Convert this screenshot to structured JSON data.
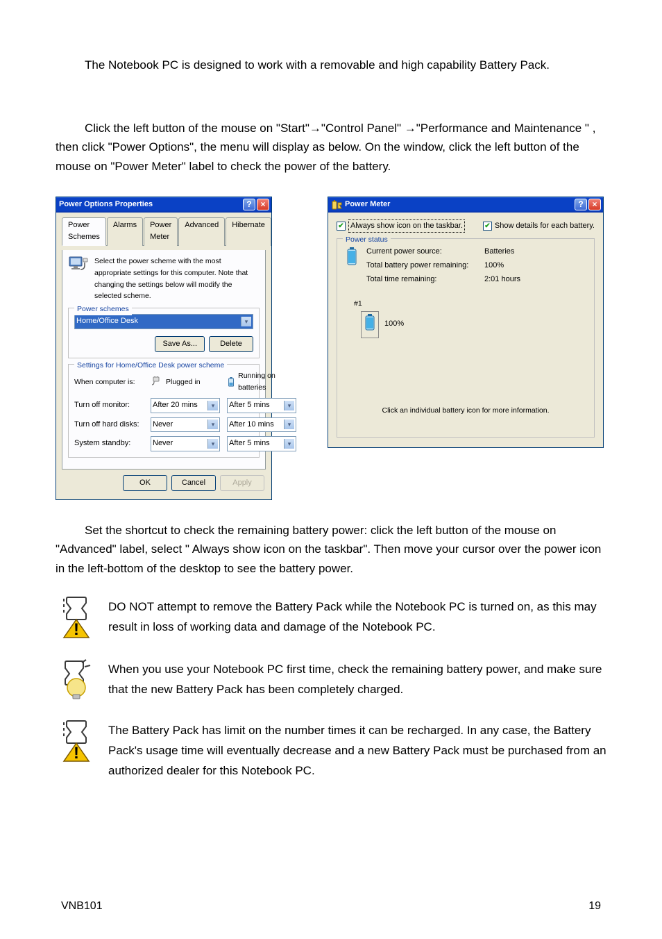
{
  "intro_paragraph": "The Notebook PC is designed to work with a removable and high capability Battery Pack.",
  "nav_paragraph": "Click the left button of the mouse on \"Start\"→\"Control Panel\"  →\"Performance and Maintenance \" , then click \"Power Options\", the menu will display as below. On the window, click the left button of the mouse on \"Power Meter\" label to check the power of the battery.",
  "pop": {
    "title": "Power Options Properties",
    "tabs": [
      "Power Schemes",
      "Alarms",
      "Power Meter",
      "Advanced",
      "Hibernate"
    ],
    "description": "Select the power scheme with the most appropriate settings for this computer. Note that changing the settings below will modify the selected scheme.",
    "group1_legend": "Power schemes",
    "scheme_selected": "Home/Office Desk",
    "save_as_btn": "Save As...",
    "delete_btn": "Delete",
    "group2_legend": "Settings for Home/Office Desk power scheme",
    "when_label": "When computer is:",
    "plugged_label": "Plugged in",
    "battery_label": "Running on batteries",
    "rows": [
      {
        "label": "Turn off monitor:",
        "plugged": "After 20 mins",
        "batt": "After 5 mins"
      },
      {
        "label": "Turn off hard disks:",
        "plugged": "Never",
        "batt": "After 10 mins"
      },
      {
        "label": "System standby:",
        "plugged": "Never",
        "batt": "After 5 mins"
      }
    ],
    "ok": "OK",
    "cancel": "Cancel",
    "apply": "Apply"
  },
  "pm": {
    "title": "Power Meter",
    "chk1": "Always show icon on the taskbar.",
    "chk2": "Show details for each battery.",
    "group_legend": "Power status",
    "lines": [
      {
        "k": "Current power source:",
        "v": "Batteries"
      },
      {
        "k": "Total battery power remaining:",
        "v": "100%"
      },
      {
        "k": "Total time remaining:",
        "v": "2:01 hours"
      }
    ],
    "batt_id": "#1",
    "batt_pct": "100%",
    "footer_hint": "Click an individual battery icon for more information."
  },
  "shortcut_paragraph": "Set the shortcut to check the remaining battery power: click the left button of the mouse on \"Advanced\" label, select \" Always show icon on the taskbar\". Then move your cursor over the power icon in the left-bottom of the desktop to see the battery power.",
  "note1": "DO NOT attempt to remove the Battery Pack while the Notebook PC is turned on, as this may result in loss of working data and damage of the Notebook PC.",
  "note2": "When you use your Notebook PC first time, check the remaining battery power, and make sure that the new Battery Pack has been completely charged.",
  "note3": "The Battery Pack has limit on the number times it can be recharged. In any case, the Battery Pack's usage time will eventually decrease and a new Battery Pack must be purchased from an authorized dealer for this Notebook PC.",
  "footer_model": "VNB101",
  "footer_page": "19"
}
